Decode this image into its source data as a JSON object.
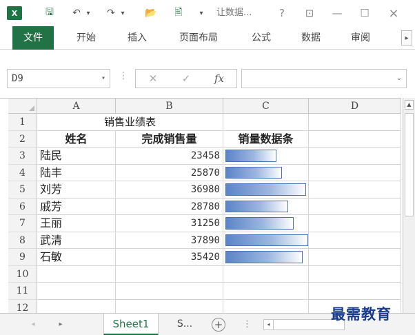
{
  "titlebar": {
    "app_icon_label": "X",
    "title": "让数据...",
    "help": "?",
    "ribbon_display": "⊡",
    "minimize": "—",
    "maximize": "☐",
    "close": "×",
    "quick_access": {
      "save": "🖫",
      "undo": "↶",
      "undo_dropdown": "▾",
      "redo": "↷",
      "redo_dropdown": "▾",
      "open": "📂",
      "print_preview": "🖹",
      "customize": "▾"
    }
  },
  "ribbon": {
    "tabs": [
      {
        "label": "文件",
        "active": true
      },
      {
        "label": "开始"
      },
      {
        "label": "插入"
      },
      {
        "label": "页面布局"
      },
      {
        "label": "公式"
      },
      {
        "label": "数据"
      },
      {
        "label": "审阅"
      }
    ],
    "scroll_right": "▸"
  },
  "formula_bar": {
    "name_box": "D9",
    "name_box_arrow": "▾",
    "dots": "⋮",
    "cancel": "✕",
    "enter": "✓",
    "fx": "fx",
    "value": "",
    "expand_arrow": "⌄"
  },
  "grid": {
    "columns": [
      "A",
      "B",
      "C",
      "D"
    ],
    "rows": [
      "1",
      "2",
      "3",
      "4",
      "5",
      "6",
      "7",
      "8",
      "9",
      "10",
      "11",
      "12"
    ],
    "title": "销售业绩表",
    "headers": [
      "姓名",
      "完成销售量",
      "销量数据条"
    ],
    "data": [
      {
        "name": "陆民",
        "sales": 23458
      },
      {
        "name": "陆丰",
        "sales": 25870
      },
      {
        "name": "刘芳",
        "sales": 36980
      },
      {
        "name": "戚芳",
        "sales": 28780
      },
      {
        "name": "王丽",
        "sales": 31250
      },
      {
        "name": "武清",
        "sales": 37890
      },
      {
        "name": "石敏",
        "sales": 35420
      }
    ],
    "data_bar_max": 37890,
    "data_bar_colors": {
      "fill_start": "#5b84c8",
      "fill_end": "#ffffff",
      "border": "#4a73b7"
    }
  },
  "sheet_tabs": {
    "nav_prev": "◂",
    "nav_next": "▸",
    "active": "Sheet1",
    "second": "S...",
    "add": "+",
    "dots": "⋮",
    "hscroll_left": "◂",
    "hscroll_right": "▸"
  },
  "watermark": "最需教育",
  "colors": {
    "accent": "#217346"
  }
}
